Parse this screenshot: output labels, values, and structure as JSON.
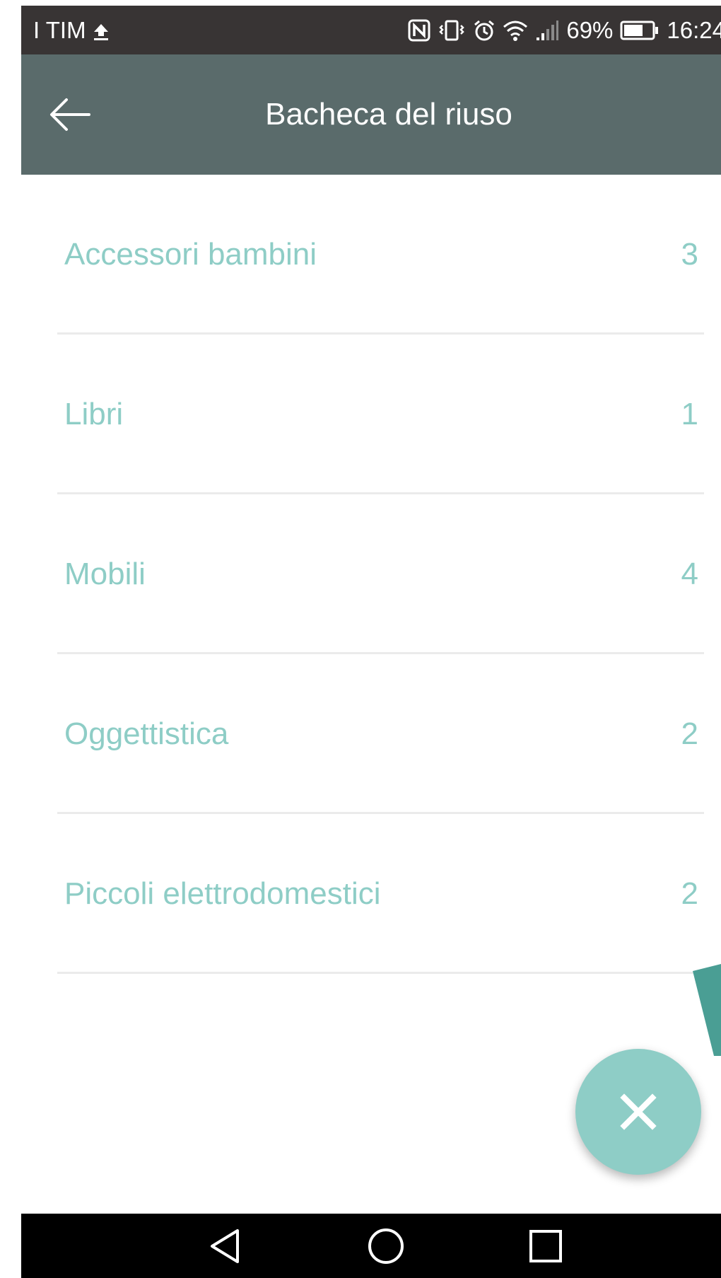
{
  "status_bar": {
    "carrier": "I TIM",
    "battery_percent": "69%",
    "time": "16:24",
    "icons": [
      "upload-icon",
      "nfc-icon",
      "vibrate-icon",
      "alarm-icon",
      "wifi-icon",
      "signal-icon",
      "battery-icon"
    ]
  },
  "app_bar": {
    "title": "Bacheca del riuso",
    "back_icon": "arrow-left-icon"
  },
  "categories": [
    {
      "name": "Accessori bambini",
      "count": "3"
    },
    {
      "name": "Libri",
      "count": "1"
    },
    {
      "name": "Mobili",
      "count": "4"
    },
    {
      "name": "Oggettistica",
      "count": "2"
    },
    {
      "name": "Piccoli elettrodomestici",
      "count": "2"
    }
  ],
  "fab": {
    "icon": "close-icon"
  },
  "nav_bar": {
    "icons": [
      "nav-back-icon",
      "nav-home-icon",
      "nav-recents-icon"
    ]
  },
  "colors": {
    "status_bar": "#383434",
    "app_bar": "#5a6b6b",
    "accent": "#8ecdc6",
    "accent_dark": "#4a9e94",
    "divider": "#ebebeb",
    "nav_bar": "#000000"
  }
}
